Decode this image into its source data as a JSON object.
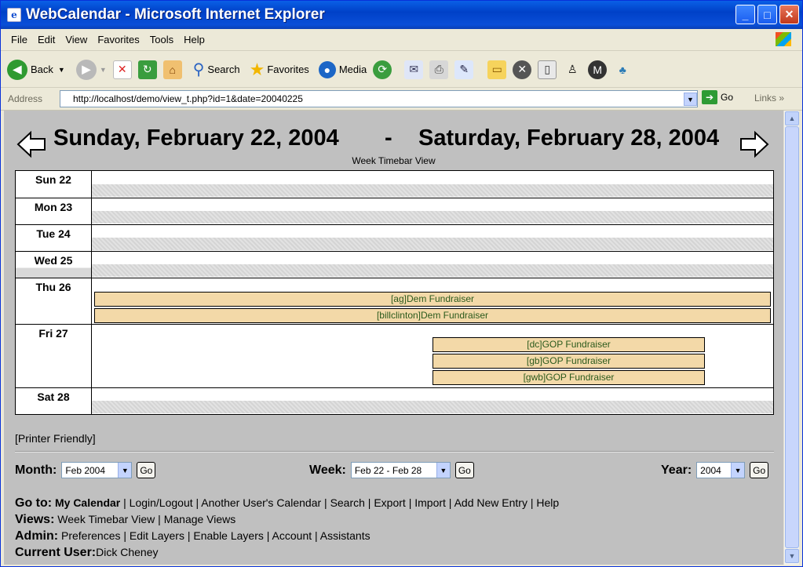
{
  "window": {
    "title": "WebCalendar - Microsoft Internet Explorer",
    "minimize_icon": "minimize-icon",
    "maximize_icon": "maximize-icon",
    "close_icon": "close-icon"
  },
  "menu": [
    "File",
    "Edit",
    "View",
    "Favorites",
    "Tools",
    "Help"
  ],
  "toolbar": {
    "back": "Back",
    "search": "Search",
    "favorites": "Favorites",
    "media": "Media"
  },
  "address": {
    "label": "Address",
    "url": "http://localhost/demo/view_t.php?id=1&date=20040225",
    "go": "Go",
    "links": "Links"
  },
  "calendar": {
    "start_date": "Sunday, February 22, 2004",
    "separator": "-",
    "end_date": "Saturday, February 28, 2004",
    "view_name": "Week Timebar View",
    "days": [
      {
        "label": "Sun 22"
      },
      {
        "label": "Mon 23"
      },
      {
        "label": "Tue 24"
      },
      {
        "label": "Wed 25"
      },
      {
        "label": "Thu 26"
      },
      {
        "label": "Fri 27"
      },
      {
        "label": "Sat 28"
      }
    ],
    "events": {
      "thu": [
        "[ag]Dem Fundraiser",
        "[billclinton]Dem Fundraiser"
      ],
      "fri": [
        "[dc]GOP Fundraiser",
        "[gb]GOP Fundraiser",
        "[gwb]GOP Fundraiser"
      ]
    },
    "event_color": "#f3d9a8",
    "event_text_color": "#2b5a1c"
  },
  "printer_friendly": "[Printer Friendly]",
  "nav": {
    "month_label": "Month:",
    "month_value": "Feb 2004",
    "week_label": "Week:",
    "week_value": "Feb 22 - Feb 28",
    "year_label": "Year:",
    "year_value": "2004",
    "go": "Go"
  },
  "footer": {
    "goto_label": "Go to:",
    "my_calendar": "My Calendar",
    "goto_links": [
      "Login/Logout",
      "Another User's Calendar",
      "Search",
      "Export",
      "Import",
      "Add New Entry",
      "Help"
    ],
    "views_label": "Views:",
    "views_links": [
      "Week Timebar View",
      "Manage Views"
    ],
    "admin_label": "Admin:",
    "admin_links": [
      "Preferences",
      "Edit Layers",
      "Enable Layers",
      "Account",
      "Assistants"
    ],
    "user_label": "Current User:",
    "user_name": "Dick Cheney"
  }
}
